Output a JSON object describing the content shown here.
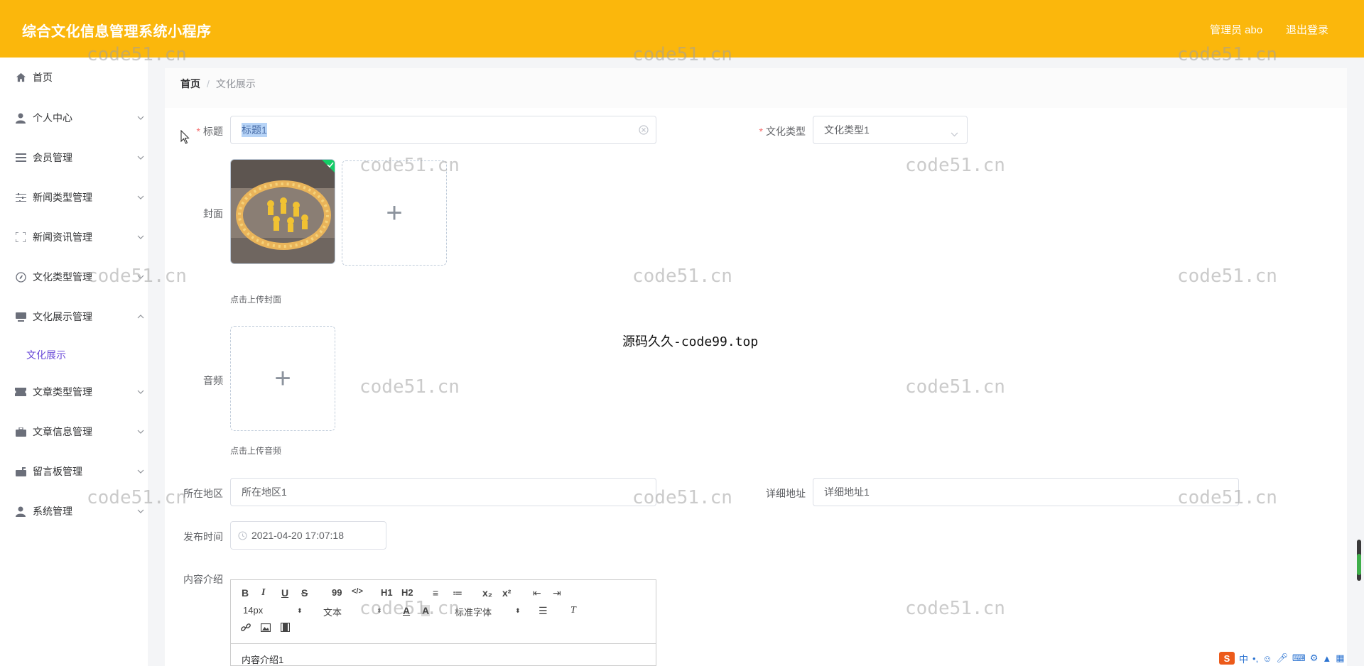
{
  "header": {
    "app_title": "综合文化信息管理系统小程序",
    "user_label": "管理员 abo",
    "logout_label": "退出登录",
    "bg_color": "#fbb70c"
  },
  "sidebar": {
    "items": [
      {
        "label": "首页",
        "icon": "home-icon"
      },
      {
        "label": "个人中心",
        "icon": "user-icon"
      },
      {
        "label": "会员管理",
        "icon": "list-icon"
      },
      {
        "label": "新闻类型管理",
        "icon": "sliders-icon"
      },
      {
        "label": "新闻资讯管理",
        "icon": "fullscreen-icon"
      },
      {
        "label": "文化类型管理",
        "icon": "compass-icon"
      },
      {
        "label": "文化展示管理",
        "icon": "monitor-icon"
      },
      {
        "label": "文章类型管理",
        "icon": "ticket-icon"
      },
      {
        "label": "文章信息管理",
        "icon": "briefcase-icon"
      },
      {
        "label": "留言板管理",
        "icon": "mailbox-icon"
      },
      {
        "label": "系统管理",
        "icon": "person-icon"
      }
    ],
    "active_sub": "文化展示",
    "accent_color": "#6a4ad8"
  },
  "breadcrumb": {
    "home": "首页",
    "separator": "/",
    "current": "文化展示"
  },
  "form": {
    "title_label": "标题",
    "title_value": "标题1",
    "type_label": "文化类型",
    "type_value": "文化类型1",
    "cover_label": "封面",
    "cover_tip": "点击上传封面",
    "audio_label": "音频",
    "audio_tip": "点击上传音频",
    "region_label": "所在地区",
    "region_value": "所在地区1",
    "address_label": "详细地址",
    "address_value": "详细地址1",
    "publish_label": "发布时间",
    "publish_value": "2021-04-20 17:07:18",
    "intro_label": "内容介绍",
    "required_mark": "*",
    "plus": "+"
  },
  "editor": {
    "buttons_row1": [
      "B",
      "I",
      "U",
      "S",
      "99",
      "</>",
      "H1",
      "H2",
      "≡",
      "≔",
      "x₂",
      "x²",
      "⇤",
      "⇥"
    ],
    "font_size": "14px",
    "text_style": "文本",
    "font_family": "标准字体",
    "content": "内容介绍1"
  },
  "watermarks": {
    "text": "code51.cn",
    "center": "源码久久-code99.top"
  }
}
